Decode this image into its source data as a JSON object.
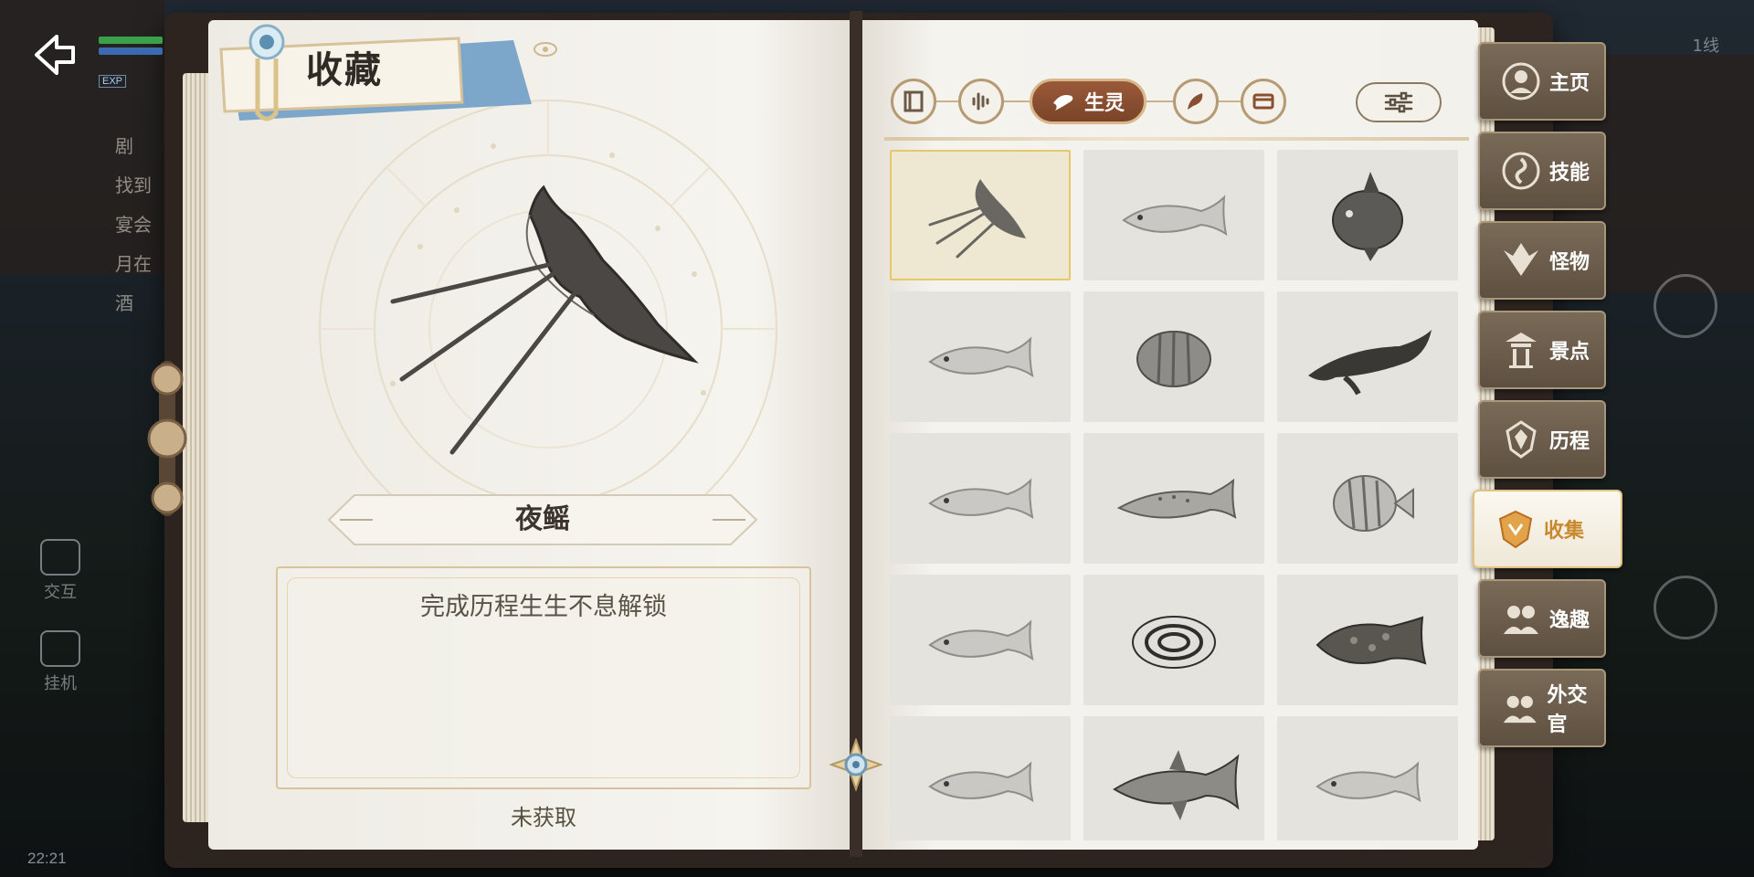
{
  "left_page": {
    "title": "收藏",
    "creature_name": "夜鳐",
    "description": "完成历程生生不息解锁",
    "status": "未获取"
  },
  "tabs": {
    "active_label": "生灵",
    "categories": [
      "book-icon",
      "sound-wave-icon",
      "creature-icon",
      "feather-icon",
      "card-icon"
    ]
  },
  "collection_grid": [
    {
      "id": "night-ray",
      "icon": "ray-icon",
      "selected": true
    },
    {
      "id": "fish-2",
      "icon": "fish-icon"
    },
    {
      "id": "sunfish",
      "icon": "sunfish-icon"
    },
    {
      "id": "fish-4",
      "icon": "fish-icon"
    },
    {
      "id": "angelfish",
      "icon": "angelfish-icon"
    },
    {
      "id": "dolphin",
      "icon": "dolphin-icon"
    },
    {
      "id": "fish-7",
      "icon": "fish-icon"
    },
    {
      "id": "salmon",
      "icon": "salmon-icon"
    },
    {
      "id": "butterflyfish",
      "icon": "butterflyfish-icon"
    },
    {
      "id": "fish-10",
      "icon": "fish-icon"
    },
    {
      "id": "striped-fish",
      "icon": "striped-fish-icon"
    },
    {
      "id": "grouper",
      "icon": "grouper-icon"
    },
    {
      "id": "fish-13",
      "icon": "fish-icon"
    },
    {
      "id": "tuna",
      "icon": "tuna-icon"
    },
    {
      "id": "fish-15",
      "icon": "fish-icon"
    }
  ],
  "side_tabs": [
    {
      "label": "主页",
      "icon": "avatar-icon"
    },
    {
      "label": "技能",
      "icon": "swirl-icon"
    },
    {
      "label": "怪物",
      "icon": "demon-emblem-icon"
    },
    {
      "label": "景点",
      "icon": "pavilion-icon"
    },
    {
      "label": "历程",
      "icon": "crest-icon"
    },
    {
      "label": "收集",
      "icon": "shield-crest-icon",
      "active": true
    },
    {
      "label": "逸趣",
      "icon": "people-icon"
    },
    {
      "label": "外交官",
      "icon": "people-icon"
    }
  ],
  "hud": {
    "exp_tag": "EXP",
    "quest_lines": [
      "剧",
      "找到",
      "宴会",
      "月在",
      "酒"
    ],
    "left_actions": [
      "交互",
      "挂机"
    ],
    "time": "22:21",
    "channel": "1线"
  },
  "colors": {
    "accent_brown": "#8a4e30",
    "gold": "#e1c37d",
    "page": "#f4f1ea",
    "tab_brown": "#6a5a48"
  }
}
